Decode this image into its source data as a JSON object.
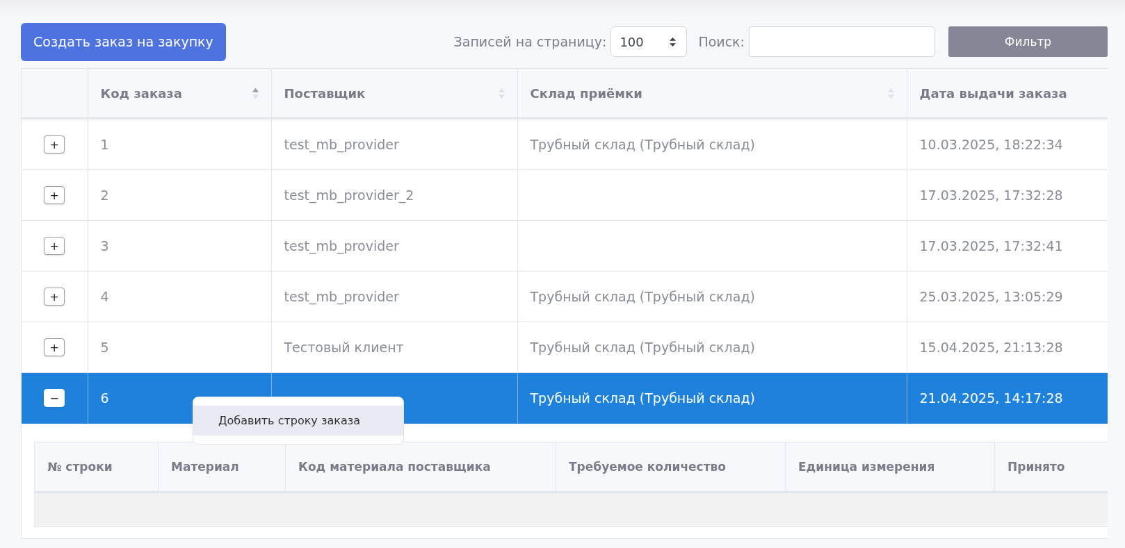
{
  "toolbar": {
    "create_button": "Создать заказ на закупку",
    "page_size_label": "Записей на страницу:",
    "page_size": "100",
    "search_label": "Поиск:",
    "filter_button": "Фильтр"
  },
  "table": {
    "columns": [
      {
        "label": "Код заказа",
        "sortable": true,
        "sorted_ascending": true
      },
      {
        "label": "Поставщик",
        "sortable": true,
        "sorted_ascending": false
      },
      {
        "label": "Склад приёмки",
        "sortable": true,
        "sorted_ascending": false
      },
      {
        "label": "Дата выдачи заказа",
        "sortable": false
      }
    ],
    "rows": [
      {
        "toggle": "+",
        "expanded": false,
        "selected": false,
        "cells": [
          "1",
          "test_mb_provider",
          "Трубный склад (Трубный склад)",
          "10.03.2025, 18:22:34"
        ]
      },
      {
        "toggle": "+",
        "expanded": false,
        "selected": false,
        "cells": [
          "2",
          "test_mb_provider_2",
          null,
          "17.03.2025, 17:32:28"
        ]
      },
      {
        "toggle": "+",
        "expanded": false,
        "selected": false,
        "cells": [
          "3",
          "test_mb_provider",
          null,
          "17.03.2025, 17:32:41"
        ]
      },
      {
        "toggle": "+",
        "expanded": false,
        "selected": false,
        "cells": [
          "4",
          "test_mb_provider",
          "Трубный склад (Трубный склад)",
          "25.03.2025, 13:05:29"
        ]
      },
      {
        "toggle": "+",
        "expanded": false,
        "selected": false,
        "cells": [
          "5",
          "Тестовый клиент",
          "Трубный склад (Трубный склад)",
          "15.04.2025, 21:13:28"
        ]
      },
      {
        "toggle": "−",
        "expanded": true,
        "selected": true,
        "cells": [
          "6",
          null,
          "Трубный склад (Трубный склад)",
          "21.04.2025, 14:17:28"
        ]
      }
    ],
    "detail": {
      "columns": [
        "№ строки",
        "Материал",
        "Код материала поставщика",
        "Требуемое количество",
        "Единица измерения",
        "Принято"
      ]
    }
  },
  "context_menu": {
    "items": [
      {
        "label": "Добавить строку заказа",
        "selected": true
      }
    ]
  }
}
